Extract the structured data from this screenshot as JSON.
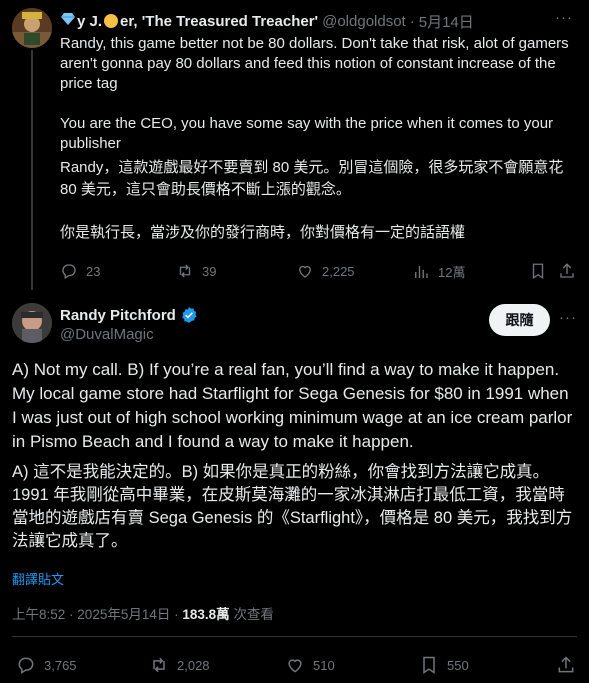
{
  "reply": {
    "name_prefix": "y J.",
    "name_suffix": "er, 'The Treasured Treacher'",
    "handle": "@oldgoldsot",
    "separator": "·",
    "date": "5月14日",
    "text_en_1": "Randy, this game better not be 80 dollars. Don't take that risk, alot of gamers aren't gonna pay 80 dollars and feed this notion of constant increase of the price tag",
    "text_en_2": "You are the CEO, you have some say with the price when it comes to your publisher",
    "text_zh_1": "Randy，這款遊戲最好不要賣到 80 美元。別冒這個險，很多玩家不會願意花 80 美元，這只會助長價格不斷上漲的觀念。",
    "text_zh_2": "你是執行長，當涉及你的發行商時，你對價格有一定的話語權",
    "stats": {
      "replies": "23",
      "reposts": "39",
      "likes": "2,225",
      "views": "12萬"
    }
  },
  "main": {
    "name": "Randy Pitchford",
    "handle": "@DuvalMagic",
    "follow_label": "跟隨",
    "text_en": "A) Not my call. B) If you’re a real fan, you’ll find a way to make it happen. My local game store had Starflight for Sega Genesis for $80 in 1991 when I was just out of high school working minimum wage at an ice cream parlor in Pismo Beach and I found a way to make it happen.",
    "text_zh": "A) 這不是我能決定的。B) 如果你是真正的粉絲，你會找到方法讓它成真。1991 年我剛從高中畢業，在皮斯莫海灘的一家冰淇淋店打最低工資，我當時當地的遊戲店有賣 Sega Genesis 的《Starflight》，價格是 80 美元，我找到方法讓它成真了。",
    "translate_label": "翻譯貼文",
    "time": "上午8:52",
    "date": "2025年5月14日",
    "views": "183.8萬",
    "views_label": "次查看",
    "stats": {
      "replies": "3,765",
      "reposts": "2,028",
      "likes": "510",
      "bookmarks": "550"
    }
  },
  "colors": {
    "background": "#000000",
    "accent": "#1d9bf0",
    "text": "#e7e9ea",
    "muted": "#71767b"
  }
}
